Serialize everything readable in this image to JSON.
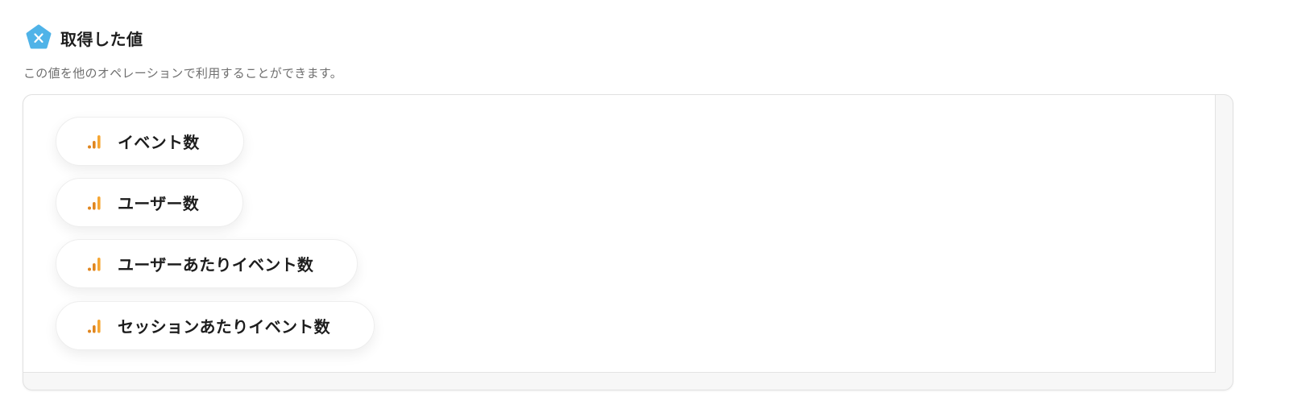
{
  "header": {
    "title": "取得した値",
    "description": "この値を他のオペレーションで利用することができます。"
  },
  "colors": {
    "badge": "#4fb3e8",
    "chart_icon": "#f29b28"
  },
  "chips": [
    {
      "label": "イベント数",
      "icon": "analytics-bar-icon"
    },
    {
      "label": "ユーザー数",
      "icon": "analytics-bar-icon"
    },
    {
      "label": "ユーザーあたりイベント数",
      "icon": "analytics-bar-icon"
    },
    {
      "label": "セッションあたりイベント数",
      "icon": "analytics-bar-icon"
    }
  ]
}
